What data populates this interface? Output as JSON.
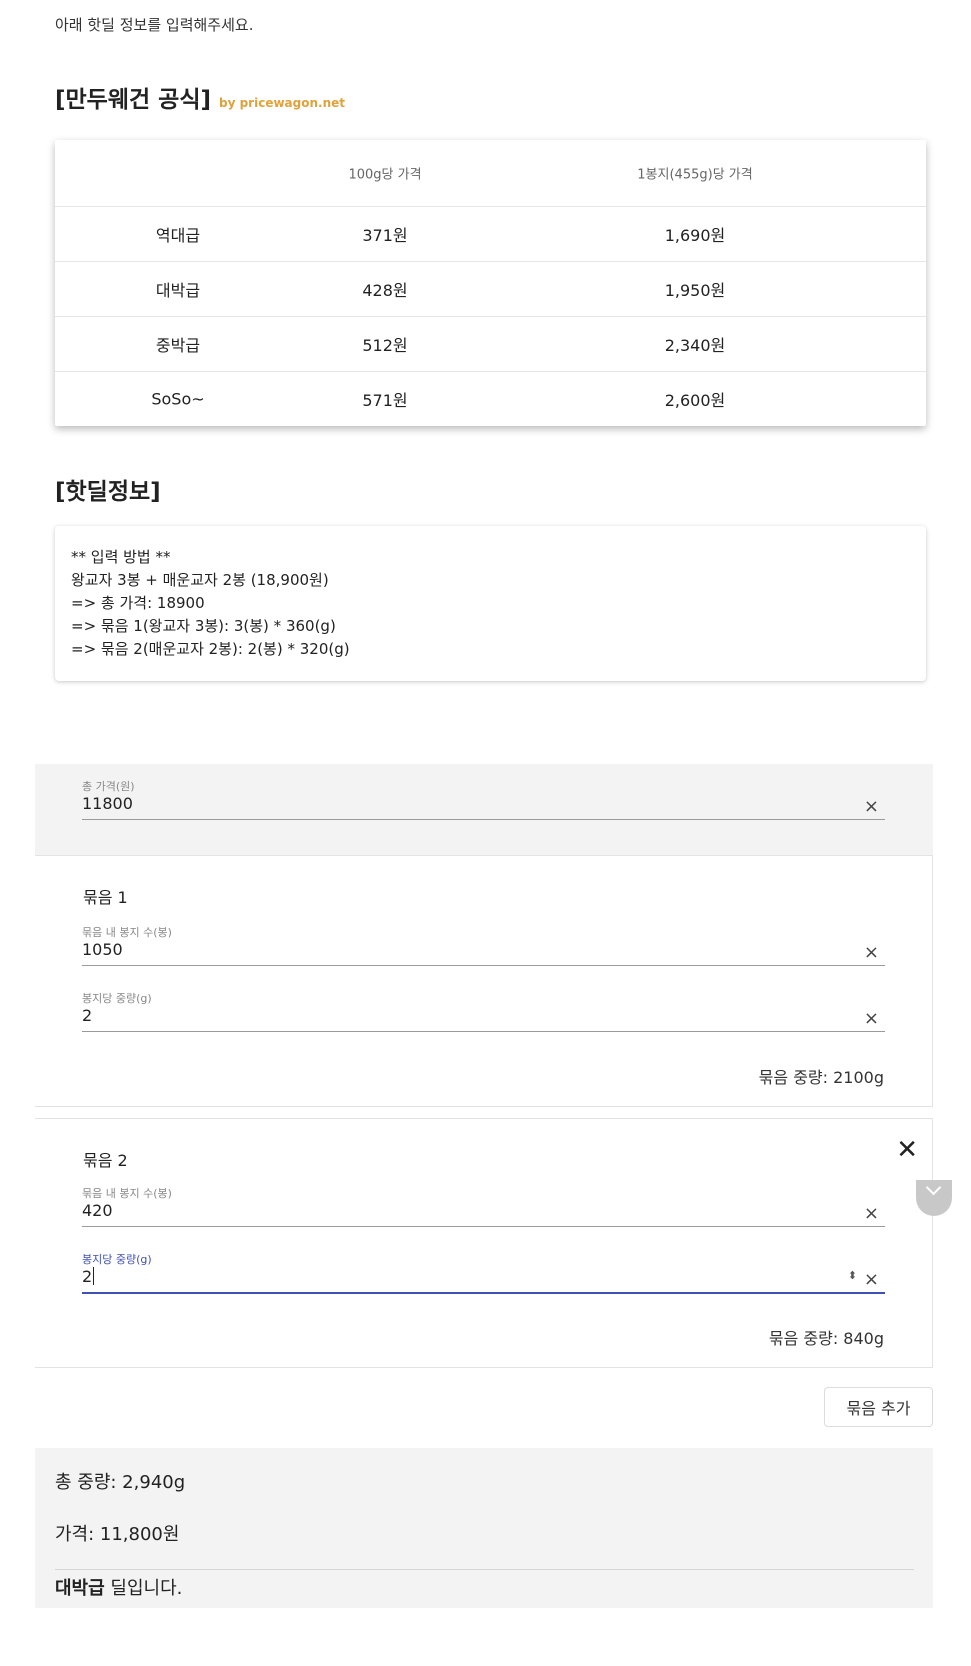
{
  "intro_text": "아래 핫딜 정보를 입력해주세요.",
  "formula": {
    "title": "[만두웨건 공식]",
    "by": "by pricewagon.net",
    "headers": [
      "",
      "100g당 가격",
      "1봉지(455g)당 가격"
    ],
    "rows": [
      {
        "grade": "역대급",
        "per100g": "371원",
        "perBag": "1,690원"
      },
      {
        "grade": "대박급",
        "per100g": "428원",
        "perBag": "1,950원"
      },
      {
        "grade": "중박급",
        "per100g": "512원",
        "perBag": "2,340원"
      },
      {
        "grade": "SoSo~",
        "per100g": "571원",
        "perBag": "2,600원"
      }
    ]
  },
  "hotdeal": {
    "title": "[핫딜정보]",
    "guide_lines": [
      "** 입력 방법 **",
      "왕교자 3봉 + 매운교자 2봉 (18,900원)",
      "=> 총 가격: 18900",
      "=> 묶음 1(왕교자 3봉): 3(봉) * 360(g)",
      "=> 묶음 2(매운교자 2봉): 2(봉) * 320(g)"
    ]
  },
  "form": {
    "total_price": {
      "label": "총 가격(원)",
      "value": "11800"
    },
    "clear_symbol": "×",
    "groups": [
      {
        "title": "묶음 1",
        "count_label": "묶음 내 봉지 수(봉)",
        "count_value": "1050",
        "weight_label": "봉지당 중량(g)",
        "weight_value": "2",
        "total_text": "묶음 중량: 2100g"
      },
      {
        "title": "묶음 2",
        "count_label": "묶음 내 봉지 수(봉)",
        "count_value": "420",
        "weight_label": "봉지당 중량(g)",
        "weight_value": "2",
        "total_text": "묶음 중량: 840g",
        "remove_symbol": "✕",
        "spinner_symbol": "⬍"
      }
    ],
    "add_button_label": "묶음 추가"
  },
  "summary": {
    "total_weight": "총 중량: 2,940g",
    "price": "가격: 11,800원",
    "verdict_grade": "대박급",
    "verdict_suffix": " 딜입니다."
  }
}
